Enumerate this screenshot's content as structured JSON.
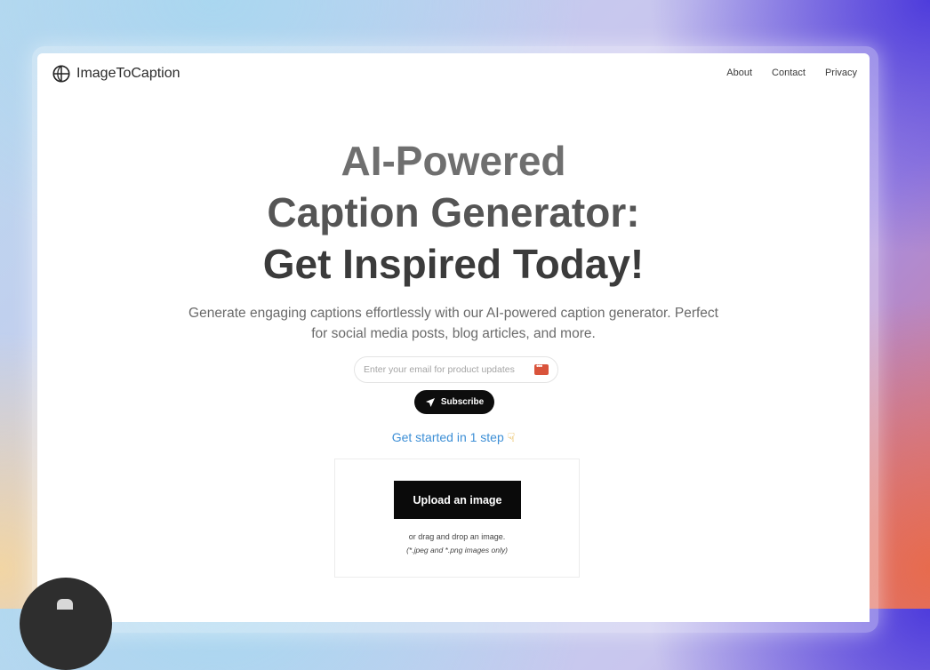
{
  "header": {
    "brand_name": "ImageToCaption",
    "brand_icon": "globe-icon",
    "nav": [
      "About",
      "Contact",
      "Privacy"
    ]
  },
  "hero": {
    "title_line1": "AI-Powered",
    "title_line2": "Caption Generator:",
    "title_line3": "Get Inspired Today!",
    "subtitle": "Generate engaging captions effortlessly with our AI-powered caption generator. Perfect for social media posts, blog articles, and more."
  },
  "subscribe": {
    "email_placeholder": "Enter your email for product updates",
    "email_value": "",
    "button_label": "Subscribe",
    "button_icon": "send-icon"
  },
  "get_started": {
    "text": "Get started in 1 step",
    "icon": "pointing-hand-icon"
  },
  "upload": {
    "button_label": "Upload an image",
    "drag_text": "or drag and drop an image.",
    "formats_text": "(*.jpeg and *.png images only)"
  },
  "colors": {
    "accent_link": "#3d8fd6",
    "button_bg": "#0d0d0d",
    "password_manager_icon": "#d9533b"
  }
}
